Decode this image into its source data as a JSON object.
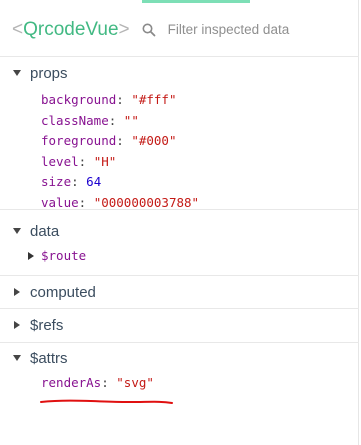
{
  "header": {
    "component_open_bracket": "<",
    "component_name": "QrcodeVue",
    "component_close_bracket": ">",
    "search_placeholder": "Filter inspected data",
    "search_value": ""
  },
  "sections": {
    "props": {
      "title": "props",
      "expanded": true,
      "rows": [
        {
          "key": "background",
          "value": "\"#fff\"",
          "type": "string"
        },
        {
          "key": "className",
          "value": "\"\"",
          "type": "string"
        },
        {
          "key": "foreground",
          "value": "\"#000\"",
          "type": "string"
        },
        {
          "key": "level",
          "value": "\"H\"",
          "type": "string"
        },
        {
          "key": "size",
          "value": "64",
          "type": "number"
        },
        {
          "key": "value",
          "value": "\"000000003788\"",
          "type": "string"
        }
      ]
    },
    "data": {
      "title": "data",
      "expanded": true,
      "rows": [
        {
          "key": "$route",
          "collapsed": true
        }
      ]
    },
    "computed": {
      "title": "computed",
      "expanded": false
    },
    "refs": {
      "title": "$refs",
      "expanded": false
    },
    "attrs": {
      "title": "$attrs",
      "expanded": true,
      "rows": [
        {
          "key": "renderAs",
          "value": "\"svg\"",
          "type": "string"
        }
      ]
    }
  },
  "colors": {
    "accent": "#42b983",
    "tab_indicator": "#7ddfb6",
    "key": "#881391",
    "string": "#c41a16",
    "number": "#1c00cf",
    "annotation": "#e01010"
  },
  "icons": {
    "search": "search-icon",
    "expanded": "triangle-down-icon",
    "collapsed": "triangle-right-icon"
  }
}
